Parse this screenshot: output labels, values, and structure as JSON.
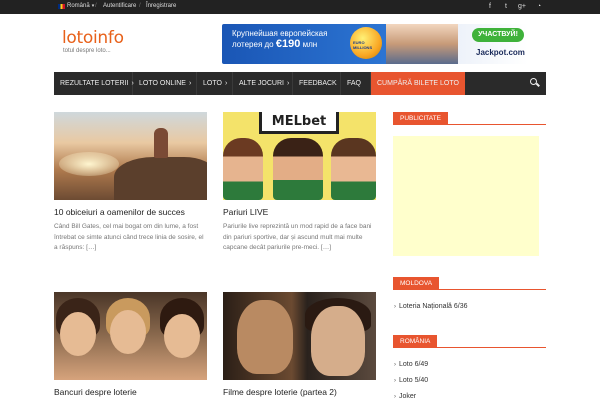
{
  "topbar": {
    "language": "Română",
    "login": "Autentificare",
    "register": "Înregistrare",
    "separator": "/",
    "social": [
      "f",
      "t",
      "g+",
      "rss"
    ]
  },
  "header": {
    "logo": "lotoinfo",
    "tagline": "totul despre loto...",
    "banner": {
      "line1": "Крупнейшая европейская",
      "line2": "лотерея до",
      "amount": "€190",
      "unit": "млн",
      "ball_text": "EURO MILLIONS",
      "cta": "УЧАСТВУЙ!",
      "brand": "Jackpot.com"
    }
  },
  "nav": {
    "items": [
      {
        "label": "Rezultate loterii",
        "chevron": true
      },
      {
        "label": "Loto Online",
        "chevron": true
      },
      {
        "label": "Loto",
        "chevron": true
      },
      {
        "label": "Alte jocuri",
        "chevron": true
      },
      {
        "label": "Feedback",
        "chevron": false
      },
      {
        "label": "FAQ",
        "chevron": false
      },
      {
        "label": "Cumpără bilete loto",
        "chevron": false
      }
    ]
  },
  "articles": [
    {
      "title": "10 obiceiuri a oamenilor de succes",
      "excerpt": "Când Bill Gates, cel mai bogat om din lume, a fost întrebat ce simte atunci când trece linia de sosire, el a răspuns: […]"
    },
    {
      "title": "Pariuri LIVE",
      "excerpt": "Pariurile live reprezintă un mod rapid de a face bani din pariuri sportive, dar și ascund mult mai multe capcane decât pariurile pre-meci. […]",
      "image_text": "MELbet"
    },
    {
      "title": "Bancuri despre loterie",
      "excerpt": ""
    },
    {
      "title": "Filme despre loterie (partea 2)",
      "excerpt": ""
    }
  ],
  "sidebar": {
    "publicity_title": "Publicitate",
    "moldova_title": "Moldova",
    "moldova_links": [
      "Loteria Națională 6/36"
    ],
    "romania_title": "România",
    "romania_links": [
      "Loto 6/49",
      "Loto 5/40",
      "Joker"
    ]
  },
  "colors": {
    "accent": "#e8552f",
    "logo": "#e8611a",
    "nav_bg": "#2a2a2a",
    "topbar_bg": "#222222",
    "ad_bg": "#ffffcc"
  }
}
